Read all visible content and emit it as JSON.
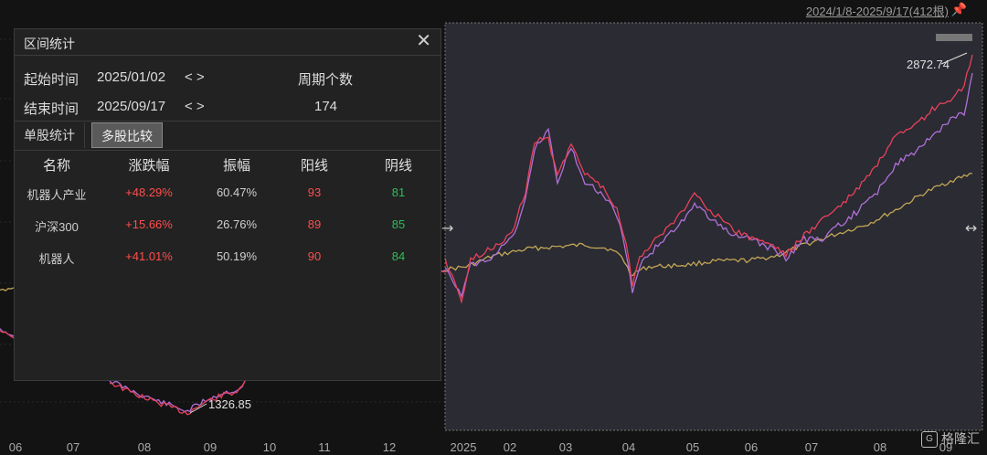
{
  "header": {
    "range_label": "2024/1/8-2025/9/17(412根)",
    "pin_icon": "pin-icon"
  },
  "panel": {
    "title": "区间统计",
    "start_label": "起始时间",
    "start_value": "2025/01/02",
    "end_label": "结束时间",
    "end_value": "2025/09/17",
    "arrows": "< >",
    "period_label": "周期个数",
    "period_value": "174",
    "tabs": [
      {
        "label": "单股统计"
      },
      {
        "label": "多股比较"
      }
    ],
    "columns": [
      "名称",
      "涨跌幅",
      "振幅",
      "阳线",
      "阴线"
    ],
    "rows": [
      {
        "name": "机器人产业",
        "change": "+48.29%",
        "amplitude": "60.47%",
        "up": "93",
        "down": "81"
      },
      {
        "name": "沪深300",
        "change": "+15.66%",
        "amplitude": "26.76%",
        "up": "89",
        "down": "85"
      },
      {
        "name": "机器人",
        "change": "+41.01%",
        "amplitude": "50.19%",
        "up": "90",
        "down": "84"
      }
    ]
  },
  "annotations": {
    "high": "2872.74",
    "low": "1326.85"
  },
  "x_axis": {
    "left_ticks": [
      "06",
      "07",
      "08",
      "09",
      "10",
      "11",
      "12"
    ],
    "right_ticks": [
      "2025",
      "02",
      "03",
      "04",
      "05",
      "06",
      "07",
      "08",
      "09"
    ]
  },
  "watermark": "格隆汇",
  "colors": {
    "background": "#131313",
    "selection": "#2a2b33",
    "series_red": "#e8415a",
    "series_purple": "#b070d8",
    "series_gold": "#c3a655",
    "up": "#ff4d4d",
    "down": "#2ebd59"
  }
}
